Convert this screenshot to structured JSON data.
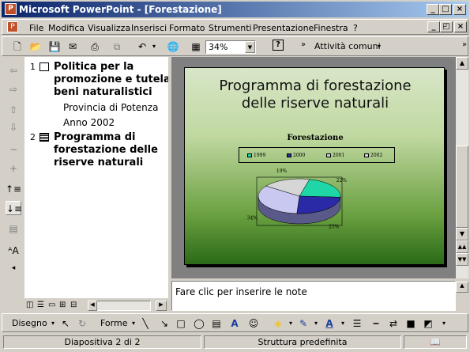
{
  "window": {
    "title": "Microsoft PowerPoint - [Forestazione]"
  },
  "menu": {
    "items": [
      "File",
      "Modifica",
      "Visualizza",
      "Inserisci",
      "Formato",
      "Strumenti",
      "Presentazione",
      "Finestra",
      "?"
    ]
  },
  "toolbar": {
    "zoom": "34%",
    "tasks": "Attività comuni"
  },
  "outline": {
    "slide1": {
      "num": "1",
      "title_lines": [
        "Politica per la",
        "promozione e tutela de",
        "beni naturalistici"
      ],
      "subs": [
        "Provincia di Potenza",
        "Anno 2002"
      ]
    },
    "slide2": {
      "num": "2",
      "title_lines": [
        "Programma di",
        "forestazione delle",
        "riserve naturali"
      ]
    }
  },
  "slide": {
    "title_lines": [
      "Programma di forestazione",
      "delle riserve naturali"
    ]
  },
  "chart_data": {
    "type": "pie",
    "title": "Forestazione",
    "categories": [
      "1999",
      "2000",
      "2001",
      "2002"
    ],
    "values": [
      22,
      25,
      34,
      19
    ],
    "labels": [
      "22%",
      "25%",
      "34%",
      "19%"
    ],
    "colors": [
      "#1fd6a6",
      "#2a2aa6",
      "#c8c8f0",
      "#d6d6d6"
    ]
  },
  "notes": {
    "placeholder": "Fare clic per inserire le note"
  },
  "drawing": {
    "draw_label": "Disegno",
    "shapes_label": "Forme"
  },
  "status": {
    "slide": "Diapositiva 2 di 2",
    "design": "Struttura predefinita"
  }
}
